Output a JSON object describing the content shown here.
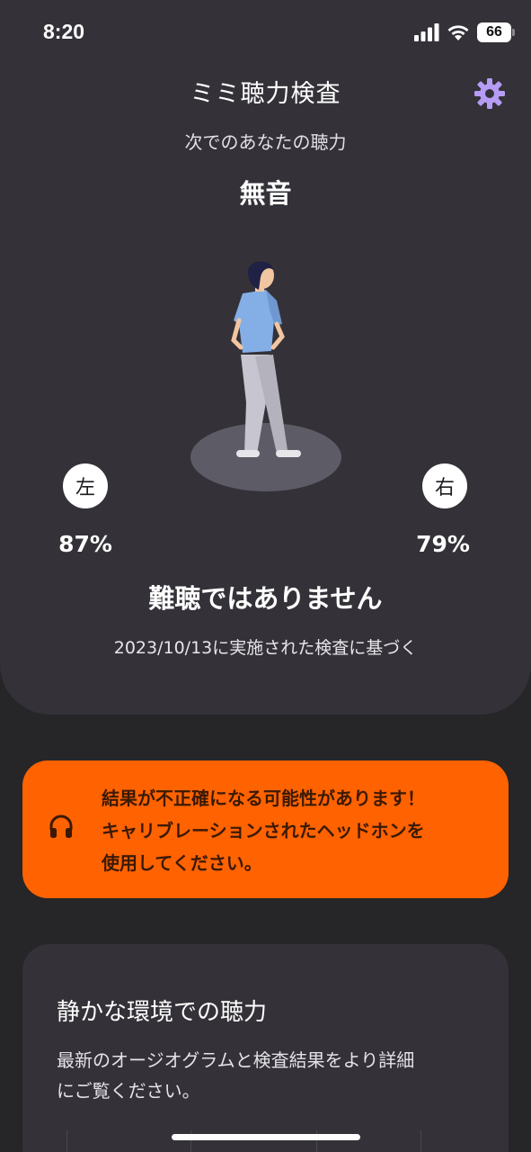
{
  "status_bar": {
    "time": "8:20",
    "battery": "66"
  },
  "header": {
    "title": "ミミ聴力検査",
    "subtitle": "次でのあなたの聴力",
    "environment": "無音"
  },
  "result": {
    "left_label": "左",
    "left_percent": "87%",
    "right_label": "右",
    "right_percent": "79%",
    "verdict": "難聴ではありません",
    "based_on": "2023/10/13に実施された検査に基づく"
  },
  "warning": {
    "lines": [
      "結果が不正確になる可能性があります！",
      "キャリブレーションされたヘッドホンを",
      "使用してください。"
    ],
    "color": "#ff6200",
    "icon": "headphones-icon"
  },
  "card": {
    "title": "静かな環境での聴力",
    "desc_lines": [
      "最新のオージオグラムと検査結果をより詳細",
      "にご覧ください。"
    ]
  },
  "colors": {
    "background": "#262528",
    "panel": "#343238",
    "accent": "#b69cf5"
  }
}
